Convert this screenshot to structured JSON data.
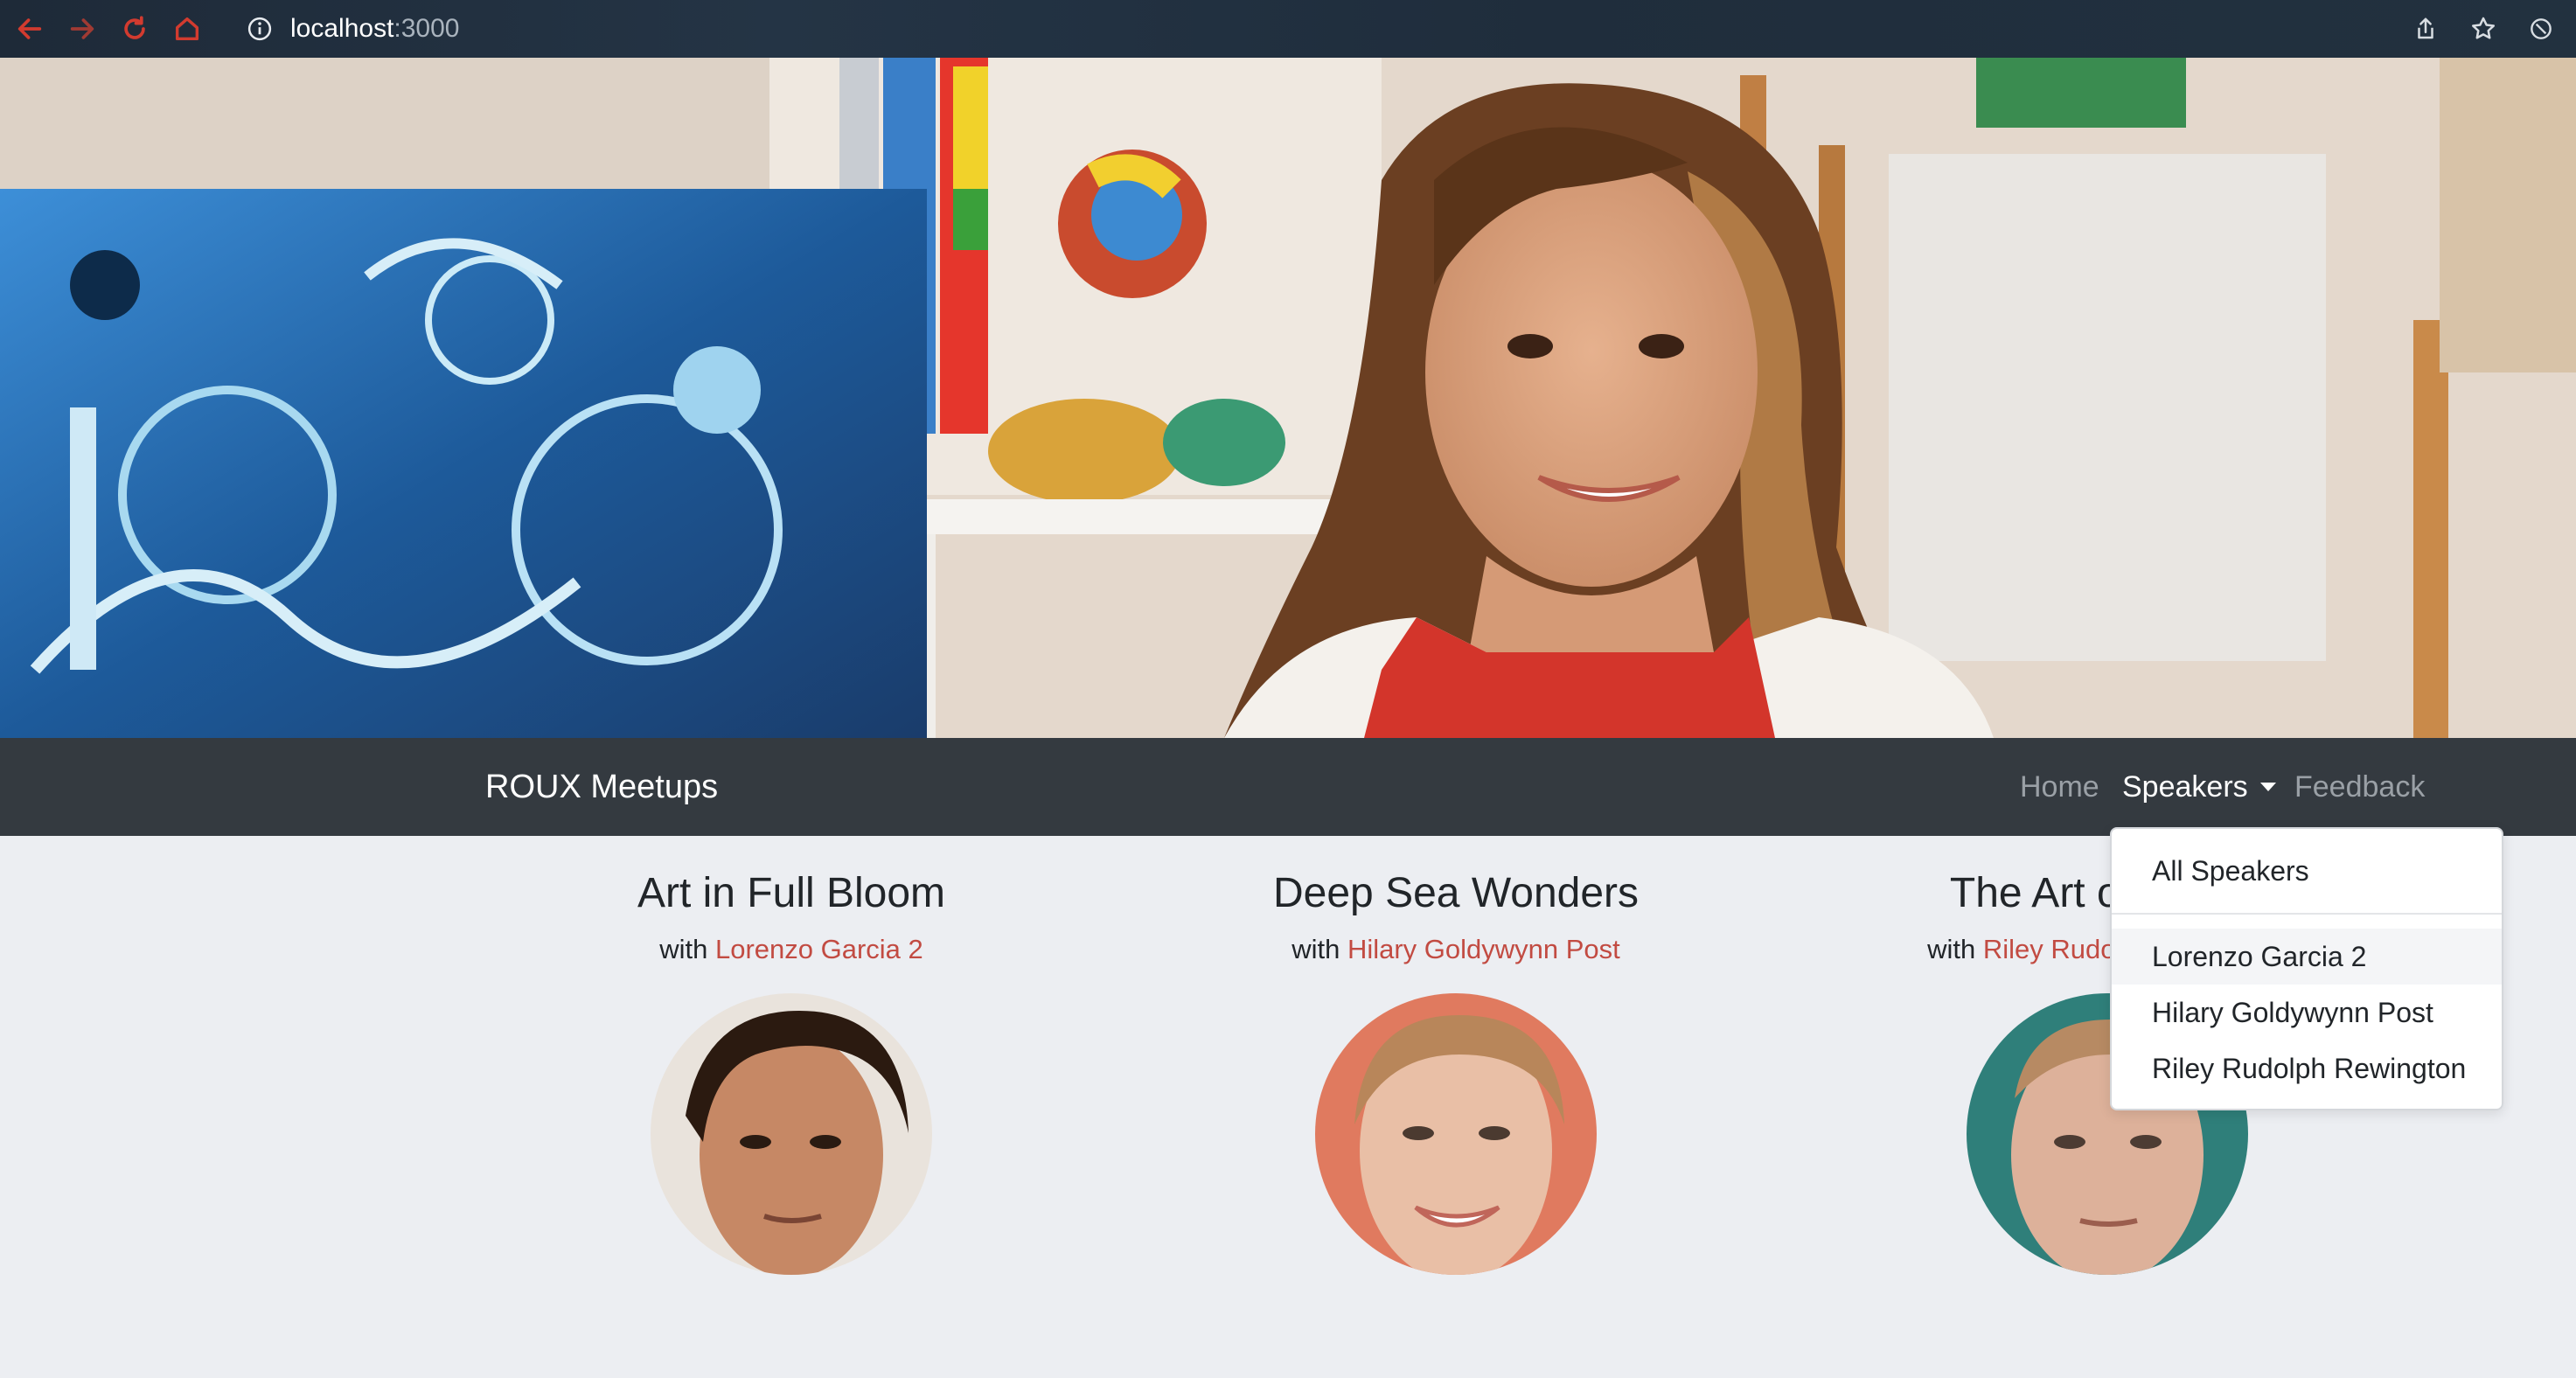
{
  "browser": {
    "url_host": "localhost",
    "url_port": ":3000"
  },
  "navbar": {
    "brand": "ROUX Meetups",
    "links": {
      "home": "Home",
      "speakers": "Speakers",
      "feedback": "Feedback"
    }
  },
  "dropdown": {
    "all_label": "All Speakers",
    "items": [
      "Lorenzo Garcia 2",
      "Hilary Goldywynn Post",
      "Riley Rudolph Rewington"
    ]
  },
  "cards": [
    {
      "title": "Art in Full Bloom",
      "with": "with",
      "speaker": "Lorenzo Garcia 2"
    },
    {
      "title": "Deep Sea Wonders",
      "with": "with",
      "speaker": "Hilary Goldywynn Post"
    },
    {
      "title": "The Art of Dance",
      "with": "with",
      "speaker": "Riley Rudolph Rewington"
    }
  ],
  "colors": {
    "navbar_bg": "#343a40",
    "page_bg": "#eceef2",
    "link_accent": "#c24b42"
  },
  "icons": {
    "back": "arrow-left-icon",
    "forward": "arrow-right-icon",
    "reload": "reload-icon",
    "home": "home-icon",
    "info": "info-icon",
    "share": "share-icon",
    "bookmark": "star-icon",
    "extension": "extension-icon"
  }
}
